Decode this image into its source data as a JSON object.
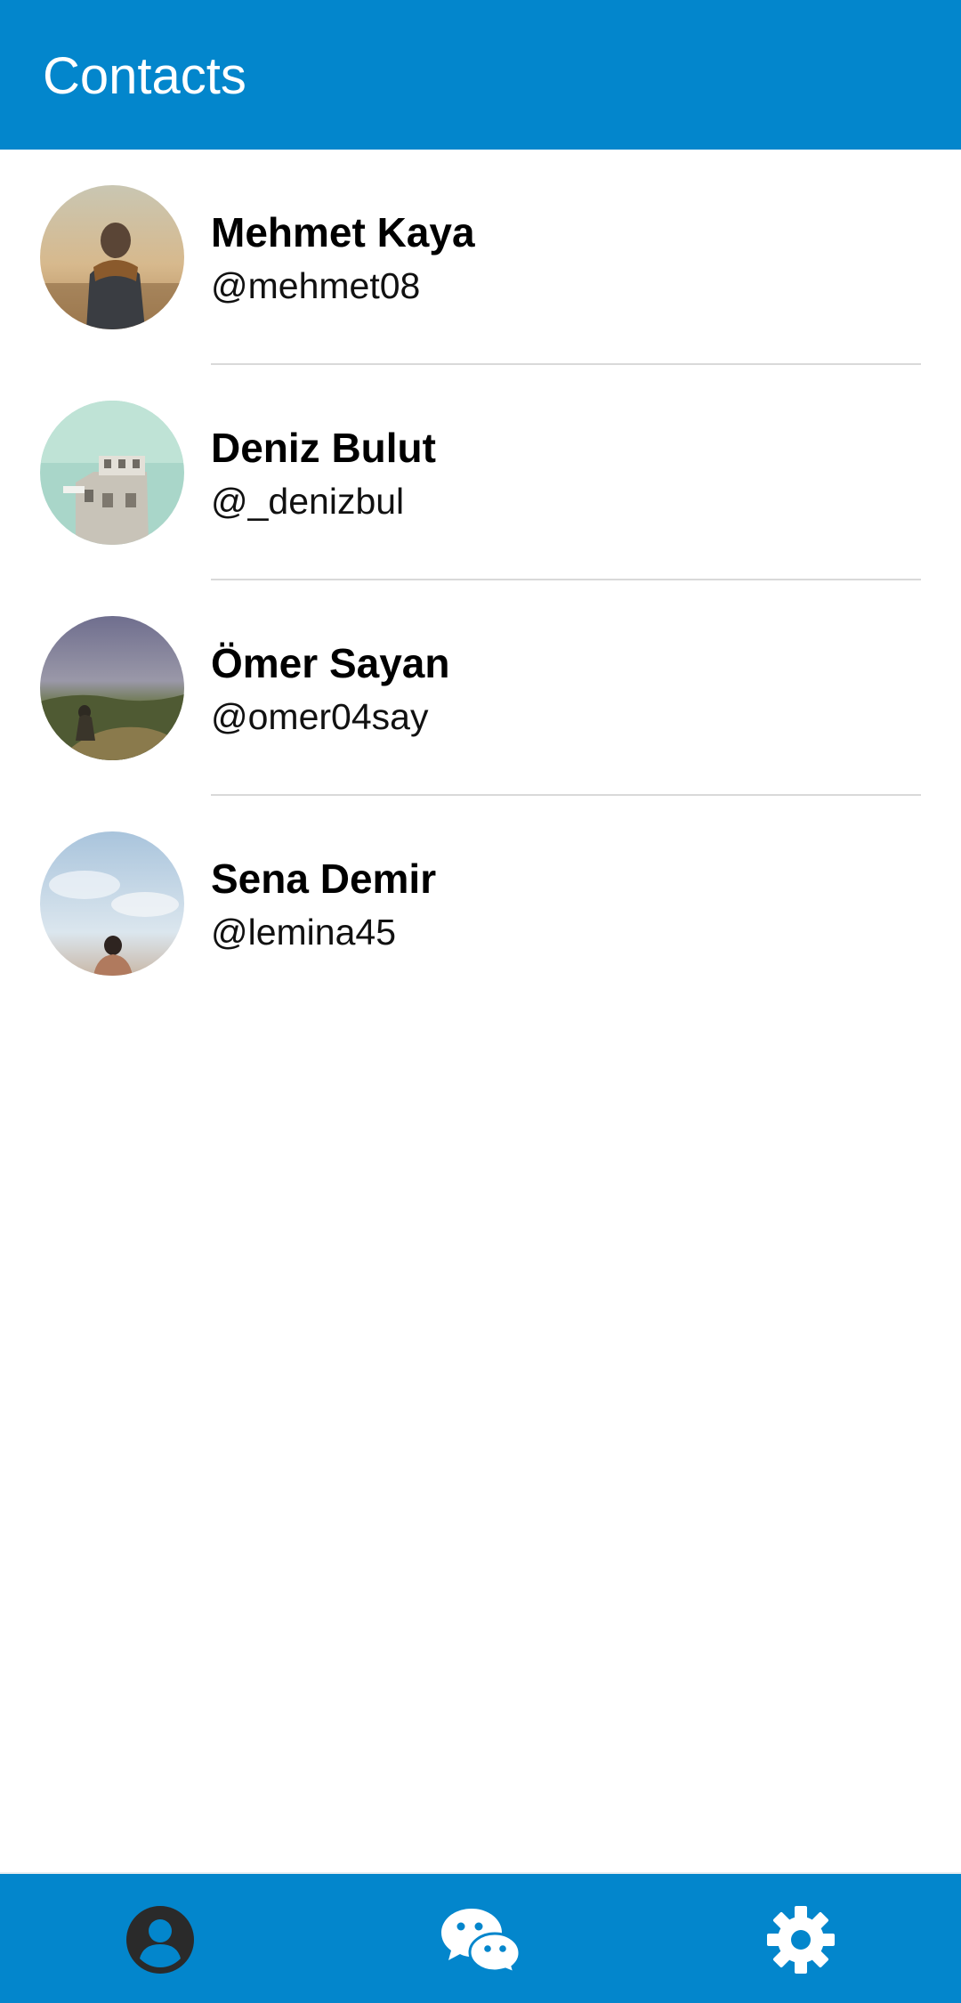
{
  "app_bar": {
    "title": "Contacts",
    "background_color": "#0386cc"
  },
  "contacts": [
    {
      "name": "Mehmet Kaya",
      "handle": "@mehmet08",
      "avatar": "photo-person-scarf-sunset"
    },
    {
      "name": "Deniz Bulut",
      "handle": "@_denizbul",
      "avatar": "photo-building-sky"
    },
    {
      "name": "Ömer Sayan",
      "handle": "@omer04say",
      "avatar": "photo-person-landscape"
    },
    {
      "name": "Sena Demir",
      "handle": "@lemina45",
      "avatar": "photo-person-clouds"
    }
  ],
  "bottom_nav": {
    "items": [
      {
        "icon": "account-circle-icon",
        "active": true,
        "color": "#2a2a2a"
      },
      {
        "icon": "chat-bubbles-icon",
        "active": false,
        "color": "#ffffff"
      },
      {
        "icon": "gear-icon",
        "active": false,
        "color": "#ffffff"
      }
    ]
  }
}
